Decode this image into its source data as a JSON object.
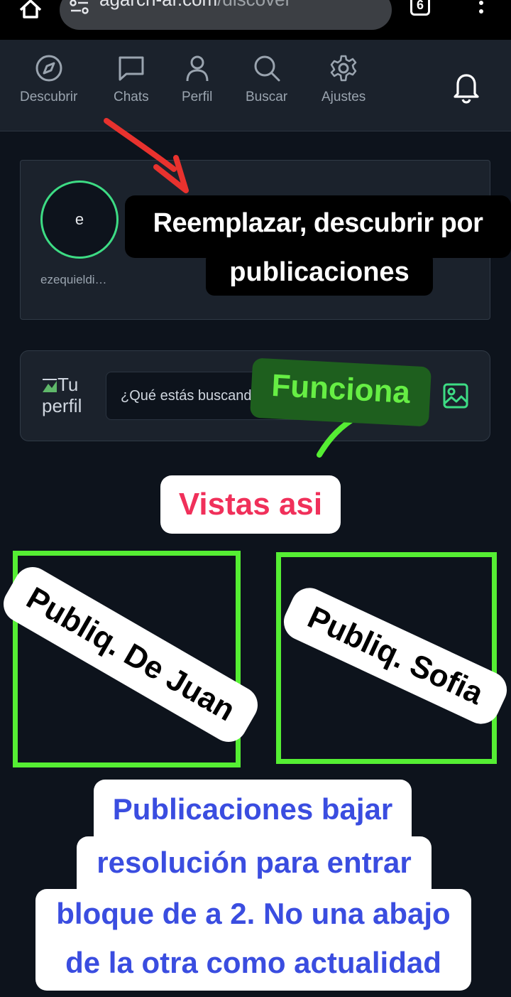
{
  "browser": {
    "url_host": "agarch-ar.com",
    "url_path": "/discover",
    "tab_count": "6"
  },
  "nav": {
    "items": [
      {
        "label": "Descubrir",
        "icon": "compass-icon"
      },
      {
        "label": "Chats",
        "icon": "chat-icon"
      },
      {
        "label": "Perfil",
        "icon": "user-icon"
      },
      {
        "label": "Buscar",
        "icon": "search-icon"
      },
      {
        "label": "Ajustes",
        "icon": "gear-icon"
      }
    ],
    "bell_icon": "bell-icon"
  },
  "stories": {
    "avatar_letter": "e",
    "username": "ezequieldi…"
  },
  "composer": {
    "broken_image_alt": "Tu perfil",
    "search_placeholder": "¿Qué estás buscando?",
    "image_icon": "image-icon"
  },
  "annotations": {
    "replace_line1": "Reemplazar, descubrir por",
    "replace_line2": "publicaciones",
    "works": "Funciona",
    "view_like": "Vistas asi",
    "post_juan": "Publiq. De Juan",
    "post_sofia": "Publiq. Sofia",
    "note_line1": "Publicaciones bajar",
    "note_line2": "resolución para entrar",
    "note_line3": "bloque de a 2. No una abajo",
    "note_line4": "de la otra como actualidad"
  },
  "colors": {
    "background": "#0d131c",
    "panel": "#1b222c",
    "accent_green": "#3ddc84",
    "frame_green": "#55ee33",
    "annotation_red": "#f0305a",
    "annotation_blue": "#3a4de0"
  }
}
